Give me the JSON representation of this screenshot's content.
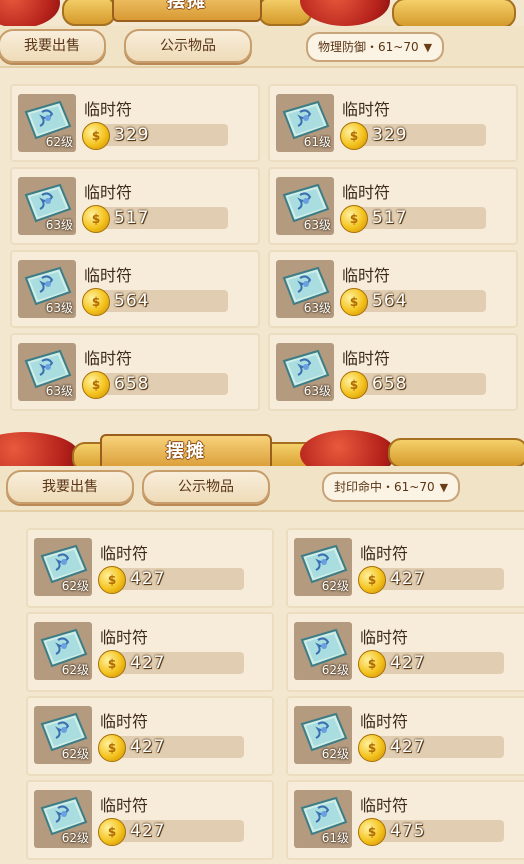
{
  "theme": {
    "accent": "#d99a34",
    "panel_bg": "#f3e7cf",
    "cell_bg": "#f7ecd9",
    "text_dark": "#3c2a1a",
    "price_text": "#ffffff"
  },
  "icons": {
    "item": "talisman-paper-icon",
    "currency": "gold-coin-icon",
    "dropdown": "dropdown-triangle-icon"
  },
  "panels": [
    {
      "title": "摆摊",
      "tabs": [
        {
          "label": "我要出售"
        },
        {
          "label": "公示物品"
        }
      ],
      "filter": {
        "label": "物理防御・61~70"
      },
      "items": [
        {
          "name": "临时符",
          "level": "62级",
          "price": "329"
        },
        {
          "name": "临时符",
          "level": "61级",
          "price": "329"
        },
        {
          "name": "临时符",
          "level": "63级",
          "price": "517"
        },
        {
          "name": "临时符",
          "level": "63级",
          "price": "517"
        },
        {
          "name": "临时符",
          "level": "63级",
          "price": "564"
        },
        {
          "name": "临时符",
          "level": "63级",
          "price": "564"
        },
        {
          "name": "临时符",
          "level": "63级",
          "price": "658"
        },
        {
          "name": "临时符",
          "level": "63级",
          "price": "658"
        }
      ]
    },
    {
      "title": "摆摊",
      "tabs": [
        {
          "label": "我要出售"
        },
        {
          "label": "公示物品"
        }
      ],
      "filter": {
        "label": "封印命中・61~70"
      },
      "items": [
        {
          "name": "临时符",
          "level": "62级",
          "price": "427"
        },
        {
          "name": "临时符",
          "level": "62级",
          "price": "427"
        },
        {
          "name": "临时符",
          "level": "62级",
          "price": "427"
        },
        {
          "name": "临时符",
          "level": "62级",
          "price": "427"
        },
        {
          "name": "临时符",
          "level": "62级",
          "price": "427"
        },
        {
          "name": "临时符",
          "level": "62级",
          "price": "427"
        },
        {
          "name": "临时符",
          "level": "62级",
          "price": "427"
        },
        {
          "name": "临时符",
          "level": "61级",
          "price": "475"
        }
      ]
    }
  ]
}
